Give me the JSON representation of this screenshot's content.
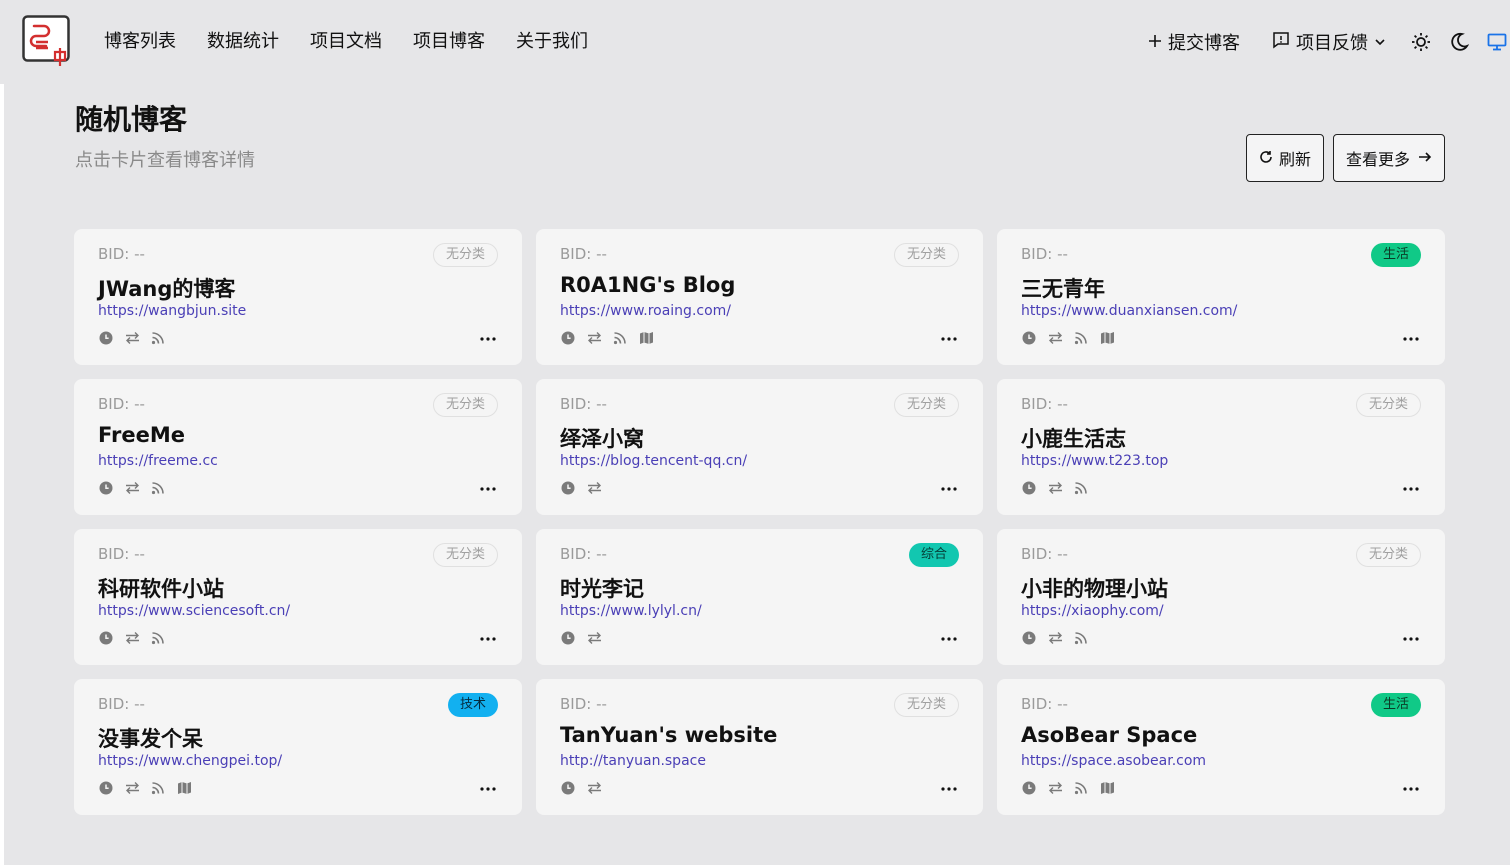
{
  "nav": {
    "items": [
      "博客列表",
      "数据统计",
      "项目文档",
      "项目博客",
      "关于我们"
    ],
    "submit_label": "提交博客",
    "feedback_label": "项目反馈"
  },
  "section": {
    "title": "随机博客",
    "subtitle": "点击卡片查看博客详情",
    "refresh_label": "刷新",
    "more_label": "查看更多"
  },
  "colors": {
    "life": "#10c987",
    "mix": "#12c7b0",
    "tech": "#12b0f0",
    "url": "#4a3fb6"
  },
  "cards": [
    {
      "bid": "BID: --",
      "category": "无分类",
      "cat_type": "none",
      "title": "JWang的博客",
      "url": "https://wangbjun.site",
      "icons": [
        "clock-icon",
        "exchange-icon",
        "rss-icon"
      ]
    },
    {
      "bid": "BID: --",
      "category": "无分类",
      "cat_type": "none",
      "title": "R0A1NG's Blog",
      "url": "https://www.roaing.com/",
      "icons": [
        "clock-icon",
        "exchange-icon",
        "rss-icon",
        "map-icon"
      ]
    },
    {
      "bid": "BID: --",
      "category": "生活",
      "cat_type": "life",
      "title": "三无青年",
      "url": "https://www.duanxiansen.com/",
      "icons": [
        "clock-icon",
        "exchange-icon",
        "rss-icon",
        "map-icon"
      ]
    },
    {
      "bid": "BID: --",
      "category": "无分类",
      "cat_type": "none",
      "title": "FreeMe",
      "url": "https://freeme.cc",
      "icons": [
        "clock-icon",
        "exchange-icon",
        "rss-icon"
      ]
    },
    {
      "bid": "BID: --",
      "category": "无分类",
      "cat_type": "none",
      "title": "绎泽小窝",
      "url": "https://blog.tencent-qq.cn/",
      "icons": [
        "clock-icon",
        "exchange-icon"
      ]
    },
    {
      "bid": "BID: --",
      "category": "无分类",
      "cat_type": "none",
      "title": "小鹿生活志",
      "url": "https://www.t223.top",
      "icons": [
        "clock-icon",
        "exchange-icon",
        "rss-icon"
      ]
    },
    {
      "bid": "BID: --",
      "category": "无分类",
      "cat_type": "none",
      "title": "科研软件小站",
      "url": "https://www.sciencesoft.cn/",
      "icons": [
        "clock-icon",
        "exchange-icon",
        "rss-icon"
      ]
    },
    {
      "bid": "BID: --",
      "category": "综合",
      "cat_type": "mix",
      "title": "时光李记",
      "url": "https://www.lylyl.cn/",
      "icons": [
        "clock-icon",
        "exchange-icon"
      ]
    },
    {
      "bid": "BID: --",
      "category": "无分类",
      "cat_type": "none",
      "title": "小非的物理小站",
      "url": "https://xiaophy.com/",
      "icons": [
        "clock-icon",
        "exchange-icon",
        "rss-icon"
      ]
    },
    {
      "bid": "BID: --",
      "category": "技术",
      "cat_type": "tech",
      "title": "没事发个呆",
      "url": "https://www.chengpei.top/",
      "icons": [
        "clock-icon",
        "exchange-icon",
        "rss-icon",
        "map-icon"
      ]
    },
    {
      "bid": "BID: --",
      "category": "无分类",
      "cat_type": "none",
      "title": "TanYuan's website",
      "url": "http://tanyuan.space",
      "icons": [
        "clock-icon",
        "exchange-icon"
      ]
    },
    {
      "bid": "BID: --",
      "category": "生活",
      "cat_type": "life",
      "title": "AsoBear Space",
      "url": "https://space.asobear.com",
      "icons": [
        "clock-icon",
        "exchange-icon",
        "rss-icon",
        "map-icon"
      ]
    }
  ]
}
